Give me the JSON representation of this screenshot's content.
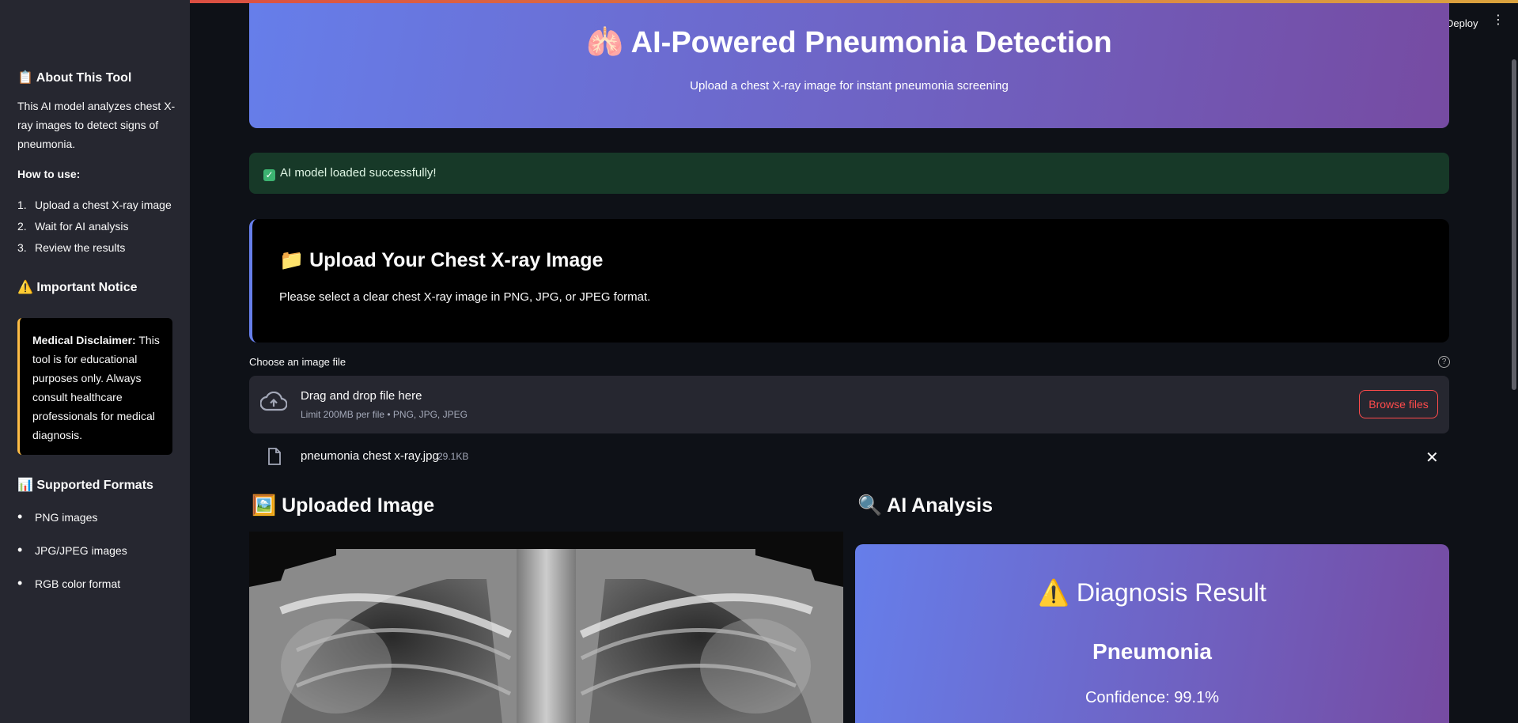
{
  "app": {
    "deploy_label": "Deploy",
    "menu_icon": "kebab-menu-icon",
    "accent": "#ff4b4b"
  },
  "sidebar": {
    "about_title": "📋 About This Tool",
    "about_text": "This AI model analyzes chest X-ray images to detect signs of pneumonia.",
    "how_title": "How to use:",
    "steps": [
      "Upload a chest X-ray image",
      "Wait for AI analysis",
      "Review the results"
    ],
    "notice_title": "⚠️ Important Notice",
    "disclaimer_bold": "Medical Disclaimer:",
    "disclaimer_text": " This tool is for educational purposes only. Always consult healthcare professionals for medical diagnosis.",
    "formats_title": "📊 Supported Formats",
    "formats": [
      "PNG images",
      "JPG/JPEG images",
      "RGB color format"
    ]
  },
  "header": {
    "title": "🫁 AI-Powered Pneumonia Detection",
    "subtitle": "Upload a chest X-ray image for instant pneumonia screening",
    "gradient_start": "#667eea",
    "gradient_end": "#764ba2"
  },
  "status": {
    "message": "AI model loaded successfully!"
  },
  "upload": {
    "title": "📁 Upload Your Chest X-ray Image",
    "description": "Please select a clear chest X-ray image in PNG, JPG, or JPEG format.",
    "field_label": "Choose an image file",
    "drop_text": "Drag and drop file here",
    "limit_text": "Limit 200MB per file • PNG, JPG, JPEG",
    "browse_label": "Browse files",
    "file_name": "pneumonia chest x-ray.jpg",
    "file_size": "29.1KB"
  },
  "uploaded_section": {
    "title": "🖼️ Uploaded Image"
  },
  "analysis_section": {
    "title": "🔍 AI Analysis",
    "result_title": "⚠️ Diagnosis Result",
    "prediction": "Pneumonia",
    "confidence": "Confidence: 99.1%"
  }
}
